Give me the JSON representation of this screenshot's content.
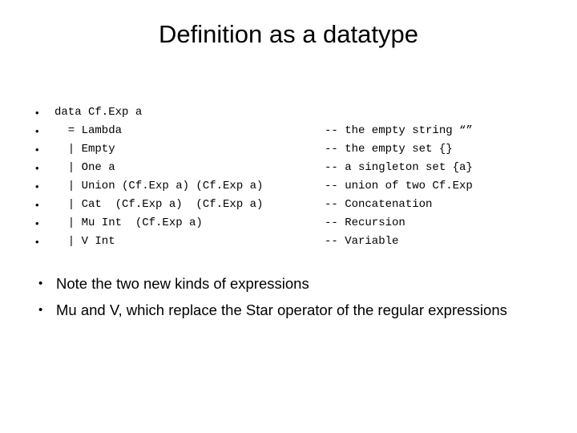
{
  "slide": {
    "title": "Definition as a datatype",
    "bullet_glyph": "•",
    "code_lines": [
      {
        "code": "data Cf.Exp a",
        "comment": ""
      },
      {
        "code": "  = Lambda",
        "comment": "-- the empty string “”"
      },
      {
        "code": "  | Empty",
        "comment": "-- the empty set {}"
      },
      {
        "code": "  | One a",
        "comment": "-- a singleton set {a}"
      },
      {
        "code": "  | Union (Cf.Exp a) (Cf.Exp a)",
        "comment": "-- union of two Cf.Exp"
      },
      {
        "code": "  | Cat  (Cf.Exp a)  (Cf.Exp a)",
        "comment": "-- Concatenation"
      },
      {
        "code": "  | Mu Int  (Cf.Exp a)",
        "comment": "-- Recursion"
      },
      {
        "code": "  | V Int",
        "comment": "-- Variable"
      }
    ],
    "notes": [
      "Note the two new kinds of expressions",
      "Mu and V, which replace the Star operator of the regular expressions"
    ]
  }
}
